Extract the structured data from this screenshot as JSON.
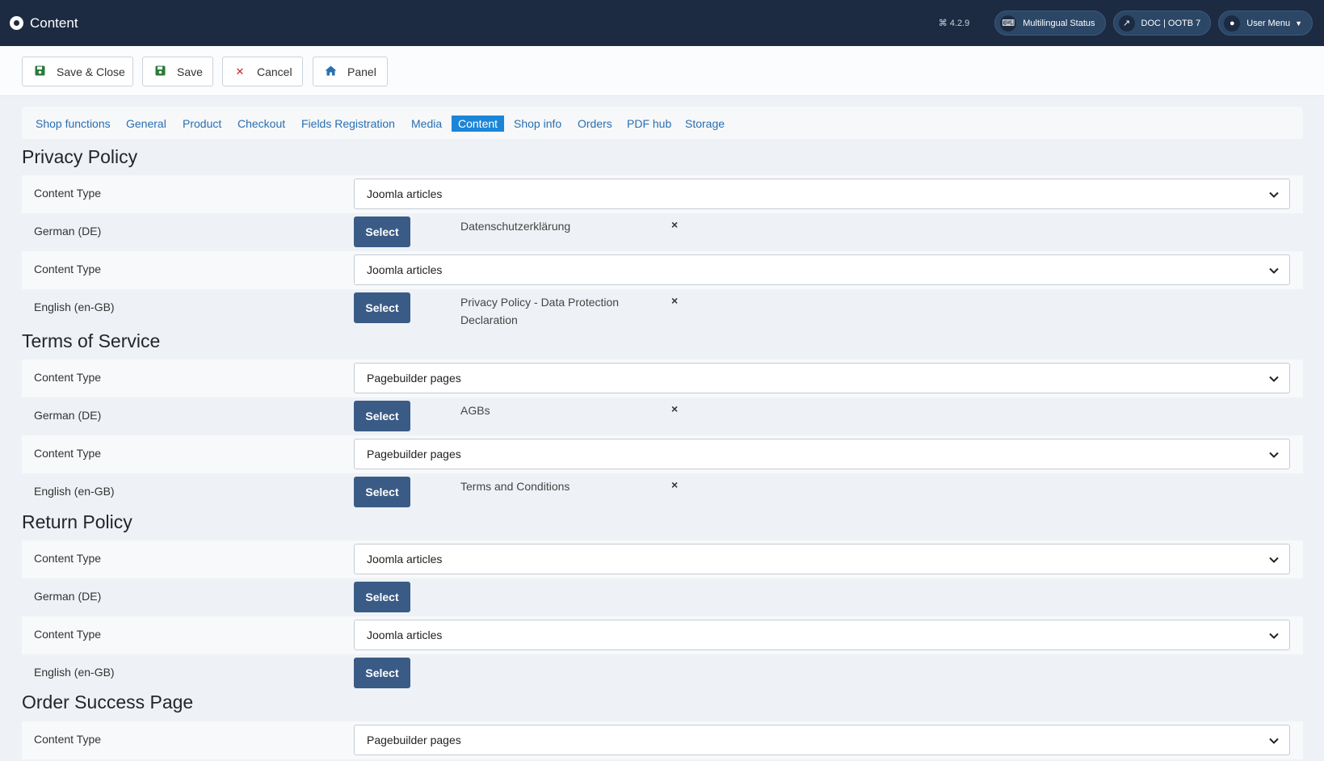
{
  "header": {
    "title": "Content",
    "version": "4.2.9",
    "multilingual_label": "Multilingual Status",
    "doc_label": "DOC | OOTB 7",
    "user_menu_label": "User Menu"
  },
  "toolbar": {
    "save_close": "Save & Close",
    "save": "Save",
    "cancel": "Cancel",
    "panel": "Panel"
  },
  "tabs": [
    "Shop functions",
    "General",
    "Product",
    "Checkout",
    "Fields Registration",
    "Media",
    "Content",
    "Shop info",
    "Orders",
    "PDF hub",
    "Storage"
  ],
  "active_tab": "Content",
  "labels": {
    "content_type": "Content Type",
    "german": "German (DE)",
    "english": "English (en-GB)",
    "select": "Select",
    "remove": "×"
  },
  "sections": [
    {
      "title": "Privacy Policy",
      "de_type": "Joomla articles",
      "de_article": "Datenschutzerklärung",
      "en_type": "Joomla articles",
      "en_article": "Privacy Policy - Data Protection Declaration"
    },
    {
      "title": "Terms of Service",
      "de_type": "Pagebuilder pages",
      "de_article": "AGBs",
      "en_type": "Pagebuilder pages",
      "en_article": "Terms and Conditions"
    },
    {
      "title": "Return Policy",
      "de_type": "Joomla articles",
      "de_article": "",
      "en_type": "Joomla articles",
      "en_article": ""
    },
    {
      "title": "Order Success Page",
      "de_type": "Pagebuilder pages"
    }
  ],
  "colors": {
    "header_bg": "#1c2b41",
    "active_tab": "#1b86d8",
    "select_button": "#3a5b86",
    "link": "#2a6fb0"
  }
}
